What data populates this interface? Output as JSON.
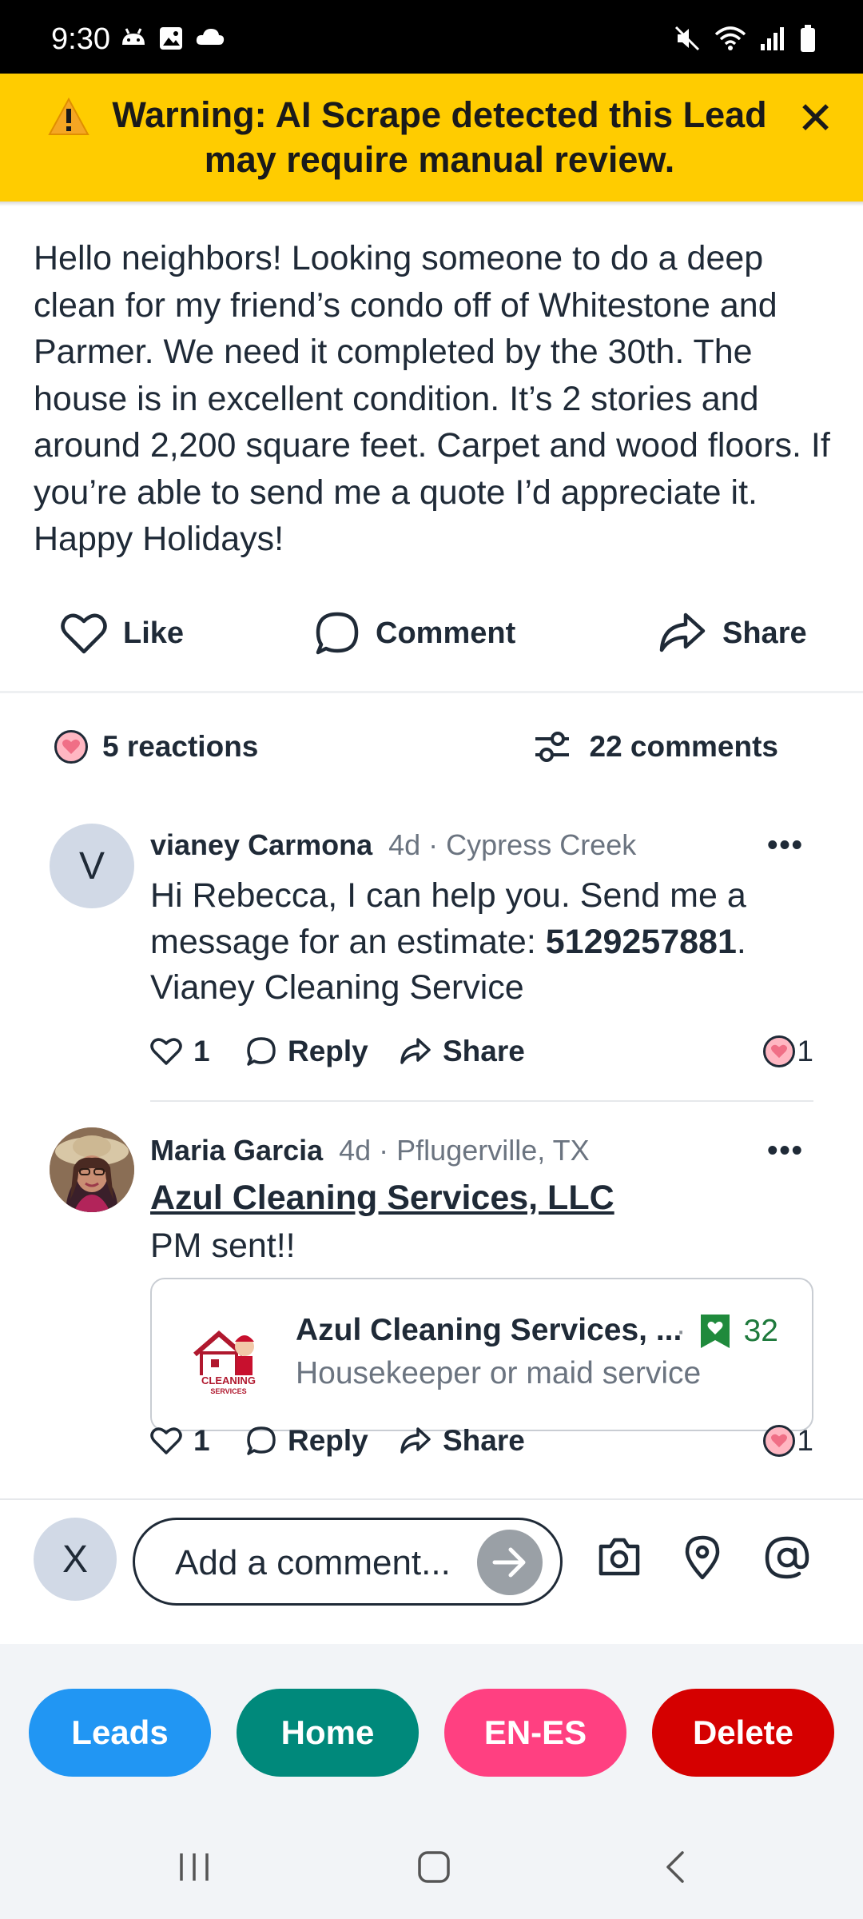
{
  "status_bar": {
    "time": "9:30"
  },
  "warning": {
    "text": "Warning: AI Scrape detected this Lead may require manual review.",
    "color": "#ffcc00"
  },
  "post": {
    "body": "Hello neighbors! Looking someone to do a deep clean for my friend’s condo off of Whitestone and Parmer. We need it completed by the 30th. The house is in excellent condition. It’s 2 stories and around 2,200 square feet. Carpet and wood floors. If you’re able to send me a quote I’d appreciate it. Happy Holidays!",
    "actions": {
      "like": "Like",
      "comment": "Comment",
      "share": "Share"
    }
  },
  "summary": {
    "reactions": "5 reactions",
    "comments": "22 comments"
  },
  "comments": [
    {
      "avatar_letter": "V",
      "name": "vianey Carmona",
      "meta": "4d · Cypress Creek",
      "text_before": "Hi Rebecca, I can help you. Send me a message for an estimate: ",
      "phone": "5129257881",
      "text_after": ". Vianey Cleaning Service",
      "like_count": "1",
      "reply": "Reply",
      "share": "Share",
      "reaction_count": "1"
    },
    {
      "name": "Maria Garcia",
      "meta": "4d · Pflugerville, TX",
      "link_title": "Azul Cleaning Services, LLC",
      "text": "PM sent!!",
      "business": {
        "name": "Azul Cleaning Services, ...",
        "faves": "32",
        "type": "Housekeeper or maid service"
      },
      "like_count": "1",
      "reply": "Reply",
      "share": "Share",
      "reaction_count": "1"
    }
  ],
  "composer": {
    "avatar_letter": "X",
    "placeholder": "Add a comment..."
  },
  "bottom_actions": [
    {
      "label": "Leads",
      "color": "#2196f3"
    },
    {
      "label": "Home",
      "color": "#00897b"
    },
    {
      "label": "EN-ES",
      "color": "#ff4081"
    },
    {
      "label": "Delete",
      "color": "#d50000"
    }
  ],
  "icons": [
    "android-icon",
    "image-icon",
    "cloud-icon",
    "mute-icon",
    "wifi-icon",
    "signal-icon",
    "battery-icon",
    "warning-icon",
    "close-icon",
    "heart-icon",
    "comment-icon",
    "share-icon",
    "filter-icon",
    "more-icon",
    "camera-icon",
    "location-icon",
    "at-icon",
    "send-arrow-icon",
    "recents-icon",
    "home-icon",
    "back-icon"
  ]
}
